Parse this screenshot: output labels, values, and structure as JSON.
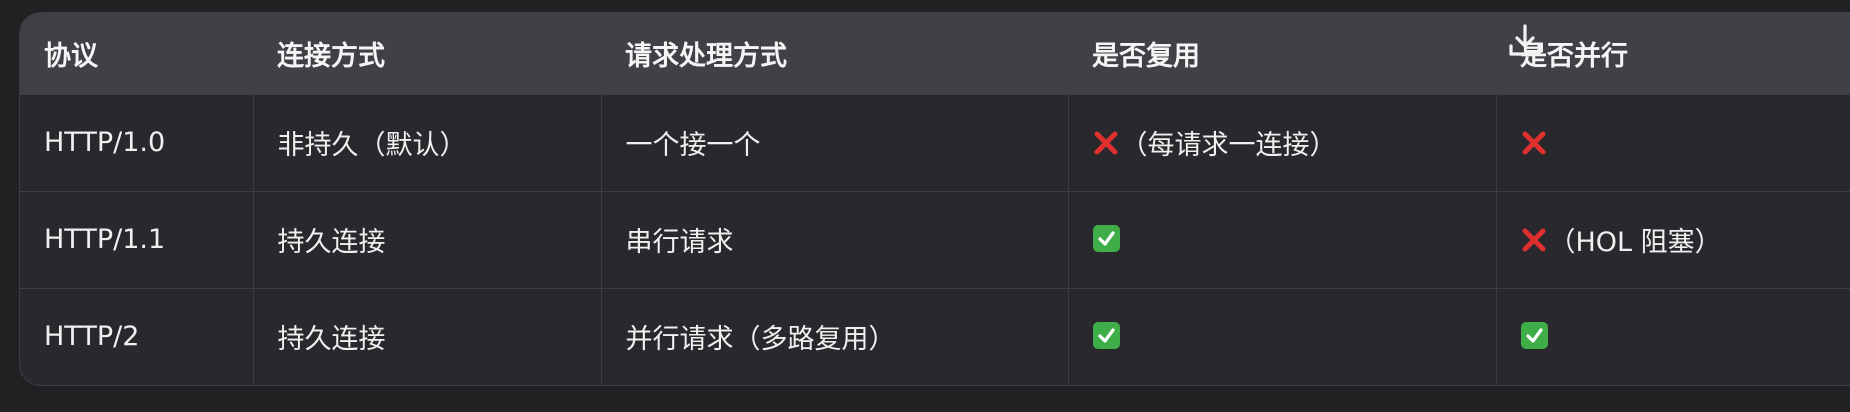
{
  "table": {
    "headers": [
      "协议",
      "连接方式",
      "请求处理方式",
      "是否复用",
      "是否并行"
    ],
    "rows": [
      {
        "protocol": "HTTP/1.0",
        "connection": "非持久（默认）",
        "handling": "一个接一个",
        "reuse": {
          "mark": "cross",
          "text": "（每请求一连接）"
        },
        "parallel": {
          "mark": "cross",
          "text": ""
        }
      },
      {
        "protocol": "HTTP/1.1",
        "connection": "持久连接",
        "handling": "串行请求",
        "reuse": {
          "mark": "check",
          "text": ""
        },
        "parallel": {
          "mark": "cross",
          "text": "（HOL 阻塞）"
        }
      },
      {
        "protocol": "HTTP/2",
        "connection": "持久连接",
        "handling": "并行请求（多路复用）",
        "reuse": {
          "mark": "check",
          "text": ""
        },
        "parallel": {
          "mark": "check",
          "text": ""
        }
      }
    ]
  },
  "toolbar": {
    "download_icon": "download-icon"
  },
  "colors": {
    "page_bg": "#212124",
    "table_bg": "#29292d",
    "header_bg": "#404146",
    "border": "#3d3e43",
    "cross": "#e0302e",
    "check": "#3fae49"
  }
}
